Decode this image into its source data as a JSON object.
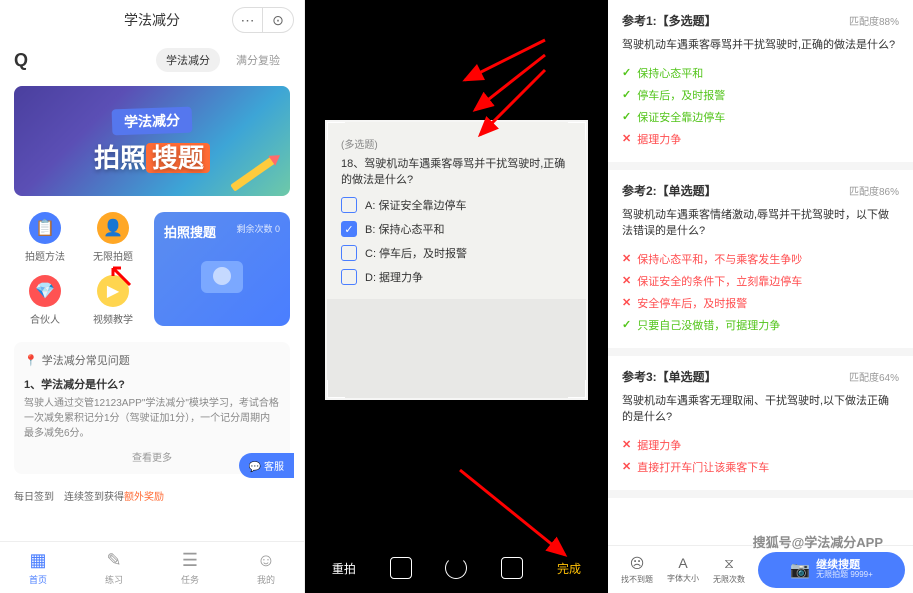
{
  "panel1": {
    "title": "学法减分",
    "tabs": [
      "学法减分",
      "满分复验"
    ],
    "banner": {
      "top": "学法减分",
      "main_a": "拍照",
      "main_b": "搜题"
    },
    "grid": [
      {
        "icon": "📋",
        "label": "拍题方法",
        "cls": "blue"
      },
      {
        "icon": "👤",
        "label": "无限拍题",
        "cls": "org"
      },
      {
        "icon": "💎",
        "label": "合伙人",
        "cls": "red"
      },
      {
        "icon": "▶",
        "label": "视频教学",
        "cls": "yel"
      }
    ],
    "bigcard": {
      "title": "拍照搜题",
      "sub": "剩余次数 0"
    },
    "faq": {
      "header": "学法减分常见问题",
      "q": "1、学法减分是什么?",
      "a": "驾驶人通过交管12123APP\"学法减分\"模块学习，考试合格一次减免累积记分1分（驾驶证加1分），一个记分周期内最多减免6分。",
      "more": "查看更多"
    },
    "kefu": "💬 客服",
    "signin": {
      "a": "每日签到",
      "b": "连续签到获得",
      "c": "额外奖励"
    },
    "tabbar": [
      {
        "icon": "▦",
        "label": "首页"
      },
      {
        "icon": "✎",
        "label": "练习"
      },
      {
        "icon": "☰",
        "label": "任务"
      },
      {
        "icon": "☺",
        "label": "我的"
      }
    ]
  },
  "panel2": {
    "paper": {
      "type": "(多选题)",
      "q": "18、驾驶机动车遇乘客辱骂并干扰驾驶时,正确的做法是什么?",
      "opts": [
        {
          "k": "A:",
          "t": "保证安全靠边停车",
          "chk": false
        },
        {
          "k": "B:",
          "t": "保持心态平和",
          "chk": true
        },
        {
          "k": "C:",
          "t": "停车后，及时报警",
          "chk": false
        },
        {
          "k": "D:",
          "t": "据理力争",
          "chk": false
        }
      ]
    },
    "bar": {
      "retake": "重拍",
      "done": "完成"
    }
  },
  "panel3": {
    "results": [
      {
        "title": "参考1:【多选题】",
        "match": "匹配度88%",
        "q": "驾驶机动车遇乘客辱骂并干扰驾驶时,正确的做法是什么?",
        "opts": [
          {
            "t": "保持心态平和",
            "ok": true
          },
          {
            "t": "停车后，及时报警",
            "ok": true
          },
          {
            "t": "保证安全靠边停车",
            "ok": true
          },
          {
            "t": "据理力争",
            "ok": false
          }
        ]
      },
      {
        "title": "参考2:【单选题】",
        "match": "匹配度86%",
        "q": "驾驶机动车遇乘客情绪激动,辱骂并干扰驾驶时，以下做法错误的是什么?",
        "opts": [
          {
            "t": "保持心态平和，不与乘客发生争吵",
            "ok": false
          },
          {
            "t": "保证安全的条件下，立刻靠边停车",
            "ok": false
          },
          {
            "t": "安全停车后，及时报警",
            "ok": false
          },
          {
            "t": "只要自己没做错，可据理力争",
            "ok": true
          }
        ]
      },
      {
        "title": "参考3:【单选题】",
        "match": "匹配度64%",
        "q": "驾驶机动车遇乘客无理取闹、干扰驾驶时,以下做法正确的是什么?",
        "opts": [
          {
            "t": "据理力争",
            "ok": false
          },
          {
            "t": "直接打开车门让该乘客下车",
            "ok": false
          }
        ]
      }
    ],
    "bottombar": {
      "items": [
        {
          "icon": "☹",
          "label": "找不到题"
        },
        {
          "icon": "A",
          "label": "字体大小"
        },
        {
          "icon": "⧖",
          "label": "无限次数"
        }
      ],
      "btn": {
        "main": "继续搜题",
        "sub": "无限拍题 9999+"
      }
    }
  },
  "watermark": "搜狐号@学法减分APP"
}
